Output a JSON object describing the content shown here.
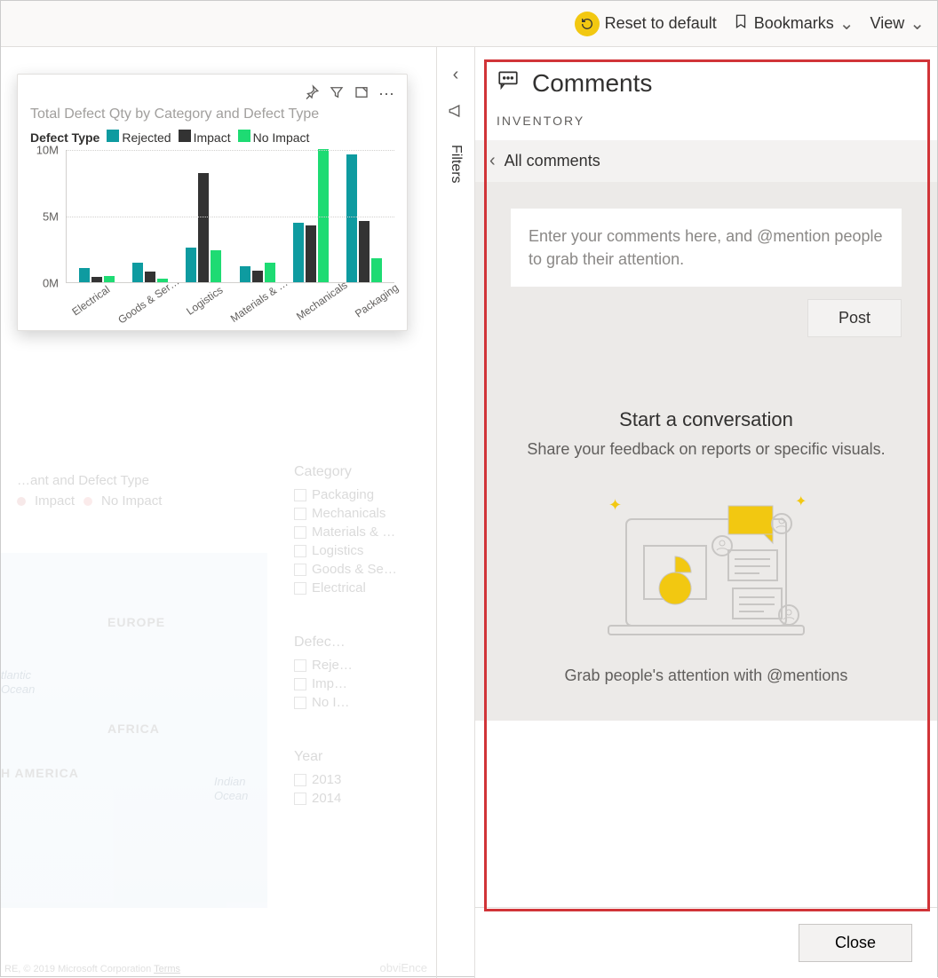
{
  "toolbar": {
    "reset_label": "Reset to default",
    "bookmarks_label": "Bookmarks",
    "view_label": "View"
  },
  "filters_rail": {
    "label": "Filters"
  },
  "visual": {
    "title": "Total Defect Qty by Category and Defect Type",
    "legend_title": "Defect Type",
    "legend_items": [
      {
        "name": "Rejected",
        "color": "#0e9ba0"
      },
      {
        "name": "Impact",
        "color": "#333333"
      },
      {
        "name": "No Impact",
        "color": "#1edb73"
      }
    ]
  },
  "chart_data": {
    "type": "bar",
    "title": "Total Defect Qty by Category and Defect Type",
    "xlabel": "",
    "ylabel": "",
    "ylim": [
      0,
      10000000
    ],
    "y_ticks": [
      "0M",
      "5M",
      "10M"
    ],
    "categories": [
      "Electrical",
      "Goods & Ser…",
      "Logistics",
      "Materials & …",
      "Mechanicals",
      "Packaging"
    ],
    "series": [
      {
        "name": "Rejected",
        "color": "#0e9ba0",
        "values": [
          1100000,
          1500000,
          2600000,
          1200000,
          4500000,
          9600000
        ]
      },
      {
        "name": "Impact",
        "color": "#333333",
        "values": [
          400000,
          800000,
          8200000,
          900000,
          4300000,
          4600000
        ]
      },
      {
        "name": "No Impact",
        "color": "#1edb73",
        "values": [
          500000,
          300000,
          2400000,
          1500000,
          10000000,
          1800000
        ]
      }
    ]
  },
  "faded": {
    "title_frag": "…ant and Defect Type",
    "legend_items": [
      "Impact",
      "No Impact"
    ],
    "category_heading": "Category",
    "category_items": [
      "Packaging",
      "Mechanicals",
      "Materials & …",
      "Logistics",
      "Goods & Se…",
      "Electrical"
    ],
    "defect_heading": "Defec…",
    "defect_items": [
      "Reje…",
      "Imp…",
      "No I…"
    ],
    "year_heading": "Year",
    "year_items": [
      "2013",
      "2014"
    ],
    "map_labels": [
      "EUROPE",
      "AFRICA",
      "H AMERICA"
    ],
    "ocean_labels": [
      "tlantic",
      "Ocean",
      "Indian",
      "Ocean"
    ],
    "attribution": "RE, © 2019 Microsoft Corporation",
    "terms": "Terms",
    "obvience": "obviEnce"
  },
  "comments": {
    "pane_title": "Comments",
    "context_label": "INVENTORY",
    "all_comments": "All comments",
    "placeholder": "Enter your comments here, and @mention people to grab their attention.",
    "post_label": "Post",
    "empty_title": "Start a conversation",
    "empty_subtitle": "Share your feedback on reports or specific visuals.",
    "grab_line": "Grab people's attention with @mentions",
    "close_label": "Close"
  }
}
